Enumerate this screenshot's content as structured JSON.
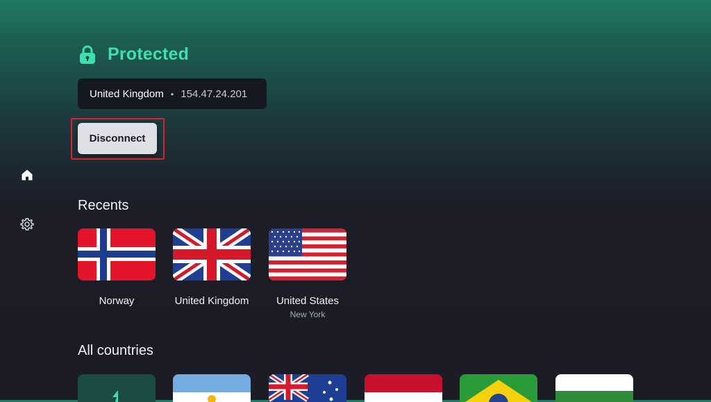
{
  "sidebar": {
    "items": [
      {
        "icon": "home-icon"
      },
      {
        "icon": "gear-icon"
      }
    ]
  },
  "status": {
    "icon": "lock-icon",
    "label": "Protected",
    "color": "#3ee0ad"
  },
  "connection": {
    "country": "United Kingdom",
    "separator": "•",
    "ip": "154.47.24.201"
  },
  "disconnect": {
    "label": "Disconnect"
  },
  "recents": {
    "title": "Recents",
    "items": [
      {
        "name": "Norway",
        "subtitle": "",
        "flag": "norway-flag"
      },
      {
        "name": "United Kingdom",
        "subtitle": "",
        "flag": "uk-flag"
      },
      {
        "name": "United States",
        "subtitle": "New York",
        "flag": "us-flag"
      }
    ]
  },
  "all_countries": {
    "title": "All countries",
    "items": [
      {
        "flag": "fastest-server-icon"
      },
      {
        "flag": "argentina-flag"
      },
      {
        "flag": "australia-flag"
      },
      {
        "flag": "austria-flag"
      },
      {
        "flag": "brazil-flag"
      },
      {
        "flag": "bulgaria-flag"
      }
    ]
  }
}
